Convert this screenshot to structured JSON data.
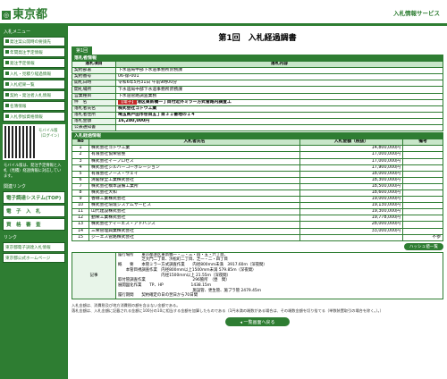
{
  "header": {
    "logo_text": "東京都",
    "service_name": "入札情報サービス"
  },
  "sidebar": {
    "menu_heading": "入札メニュー",
    "items": [
      {
        "label": "発注案公開時の要請先"
      },
      {
        "label": "年間発注予定情報"
      },
      {
        "label": "発注予定情報"
      },
      {
        "label": "入札・見積り経過情報"
      },
      {
        "label": "入札結果一覧"
      },
      {
        "label": "契約・発注者入札情報"
      },
      {
        "label": "名簿情報"
      },
      {
        "label": "入札参加資格情報"
      }
    ],
    "qr_caption": "モバイル版（ログイン）",
    "qr_note": "モバイル版は、発注予定情報と入札（見積）経過情報に対応しています。",
    "services_heading": "関連リンク",
    "service_buttons": [
      {
        "label": "電子調達システム(TOP)"
      },
      {
        "label": "電　子　入　札"
      },
      {
        "label": "資　格　審　査"
      }
    ],
    "links_heading": "リンク",
    "footer_links": [
      {
        "label": "東京都電子調達入札情報"
      },
      {
        "label": "東京都公式ホームページ"
      }
    ]
  },
  "main": {
    "title": "第1回　入札経過調書",
    "round_tab": "第1回",
    "section_bid": "落札者情報",
    "bid_header": {
      "item": "落札項目",
      "content": "落札内容"
    },
    "bid_rows": [
      {
        "label": "契約部署",
        "value": "下水道局中部下水道事務所庶務課"
      },
      {
        "label": "契約番号",
        "value": "06-郁-001"
      },
      {
        "label": "開札日時",
        "value": "令和6年5月31日 午前9時00分"
      },
      {
        "label": "開札場所",
        "value": "下水道局中部下水道事務所庶務課"
      },
      {
        "label": "営業種目",
        "value": "下水道管路調査業務"
      },
      {
        "label": "件　名",
        "badge": "【電子】",
        "value": "港区東新橋一丁目付近外ミラー方式管路内調査工"
      },
      {
        "label": "落札者氏名",
        "value": "株式会社ゴトウ工業"
      },
      {
        "label": "落札者住所",
        "value": "埼玉県戸田市笹目五丁目３１番地の１４"
      },
      {
        "label": "落札金額",
        "value": "16,280,000円"
      },
      {
        "label": "公表通知書",
        "value": ""
      }
    ],
    "section_history": "入札経過情報",
    "history_header": {
      "no": "No",
      "name": "入札者氏名",
      "amount": "入札金額（税抜）",
      "remark": "備考"
    },
    "history_rows": [
      {
        "no": "1",
        "name": "株式会社ゴトウ工業",
        "amount": "14,800,000円",
        "remark": ""
      },
      {
        "no": "2",
        "name": "有限会社協栄管整",
        "amount": "17,000,000円",
        "remark": ""
      },
      {
        "no": "3",
        "name": "株式会社イープロセス",
        "amount": "17,000,000円",
        "remark": ""
      },
      {
        "no": "4",
        "name": "株式会社シルバーコーポレーション",
        "amount": "17,900,000円",
        "remark": ""
      },
      {
        "no": "5",
        "name": "有限会社ノース・ウェイ",
        "amount": "18,000,000円",
        "remark": ""
      },
      {
        "no": "6",
        "name": "清閣保全工業株式会社",
        "amount": "18,300,000円",
        "remark": ""
      },
      {
        "no": "7",
        "name": "株式会社橋本設備工業所",
        "amount": "18,500,000円",
        "remark": ""
      },
      {
        "no": "8",
        "name": "株式会社大和",
        "amount": "18,600,000円",
        "remark": ""
      },
      {
        "no": "9",
        "name": "香緑工業株式会社",
        "amount": "19,000,000円",
        "remark": ""
      },
      {
        "no": "10",
        "name": "株式会社環境システムサービス",
        "amount": "19,130,000円",
        "remark": ""
      },
      {
        "no": "11",
        "name": "山代建設株式会社",
        "amount": "19,300,000円",
        "remark": ""
      },
      {
        "no": "12",
        "name": "勤栄工業株式会社",
        "amount": "19,778,000円",
        "remark": ""
      },
      {
        "no": "13",
        "name": "株式会社ティーエス・アドバンス",
        "amount": "28,000,000円",
        "remark": ""
      },
      {
        "no": "14",
        "name": "三栄管理興業株式会社",
        "amount": "33,000,000円",
        "remark": ""
      },
      {
        "no": "15",
        "name": "ジーエス管路株式会社",
        "amount": "",
        "remark": "不参"
      }
    ],
    "history_button": "ハッシュ値一覧",
    "notes_label": "記事",
    "notes_text": "履行場所　　東京都港区東新橋一・二・三・四・五・六丁目、\n　　　　　　芝大門二丁目、浜松町二丁目、芝一・二・四丁目\n概　　要　　本管ミラー方式調査作業　　内径800mm未満　3917.60ｍ（深夜間）\n　　本管目視調査作業　内径800mm以上1500mm未満 579.85ｍ（深夜間）\n　　　　　　　　　　　内径1500mm以上 21.55ｍ（深夜間）\n取付管調査作業　　　　　　　　　　　　296箇所　（昼　間）\n展開図化作業　　TP、HP　　　　　　　1438.15ｍ\n　　　　　　　　　　　　　　　　　　　施設管、更生管、施ブラ管 2479.45ｍ\n履行期間　　契約確定の日の翌日から70日間",
    "footnote": "入札金額は、消費税及び地方消費税の額を含まない金額である。\n落札金額は、入札金額に記載される金額に100分の10に相当する金額を加算したものである（1円未満の端数がある場合は、その端数金額を切り捨てる（単数装置取引の場合を除く。）。）",
    "back_button": "一覧画面へ戻る"
  },
  "colors": {
    "accent": "#2e7d32",
    "light": "#c8e6c9",
    "badge": "#c62828"
  }
}
